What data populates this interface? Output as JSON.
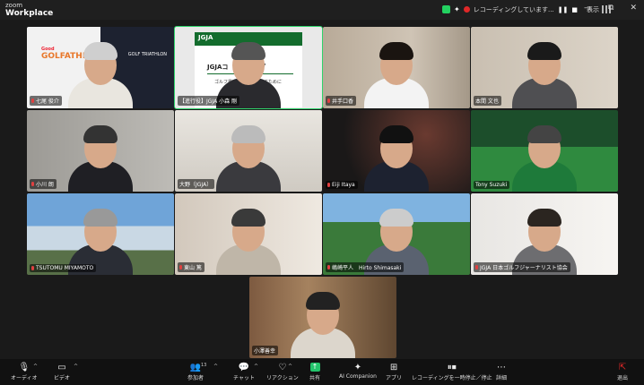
{
  "app": {
    "logo_top": "zoom",
    "logo_bottom": "Workplace"
  },
  "recording": {
    "text": "レコーディングしています...",
    "pause": "❚❚",
    "stop": "■"
  },
  "view": {
    "label": "表示"
  },
  "window": {
    "minimize": "—",
    "restore": "⧉",
    "close": "✕"
  },
  "tiles": [
    {
      "name": "七尾 俊介"
    },
    {
      "name": "【進行役】JGJA 小森 剛"
    },
    {
      "name": "井手口香"
    },
    {
      "name": "本間 文也"
    },
    {
      "name": "小川 朗"
    },
    {
      "name": "大野（JGJA）"
    },
    {
      "name": "Eiji Itaya"
    },
    {
      "name": "Tony Suzuki"
    },
    {
      "name": "TSUTOMU MIYAMOTO"
    },
    {
      "name": "東山 篤"
    },
    {
      "name": "嶋崎平人　Hirto Shimasaki"
    },
    {
      "name": "JGJA 日本ゴルフジャーナリスト協会"
    },
    {
      "name": "小澤善幸"
    }
  ],
  "tile_content": {
    "golf_logo": "GOLFATHLON",
    "golf_logo_top": "Good",
    "golf_right": "GOLF TRIATHLON",
    "slide_logo": "JGJA",
    "slide_title": "JGJAコ　　　ィング",
    "slide_sub": "ゴルフ界に元　　　　やすために"
  },
  "toolbar": {
    "audio": "オーディオ",
    "video": "ビデオ",
    "participants": "参加者",
    "participants_count": "13",
    "chat": "チャット",
    "reactions": "リアクション",
    "share": "共有",
    "ai_companion": "AI Companion",
    "apps": "アプリ",
    "recording": "レコーディングを一時停止／停止",
    "more": "詳細",
    "leave": "退出"
  },
  "colors": {
    "active_border": "#2fd36b",
    "muted_mic": "#e04040",
    "share": "#23c46b",
    "leave": "#e02828"
  }
}
